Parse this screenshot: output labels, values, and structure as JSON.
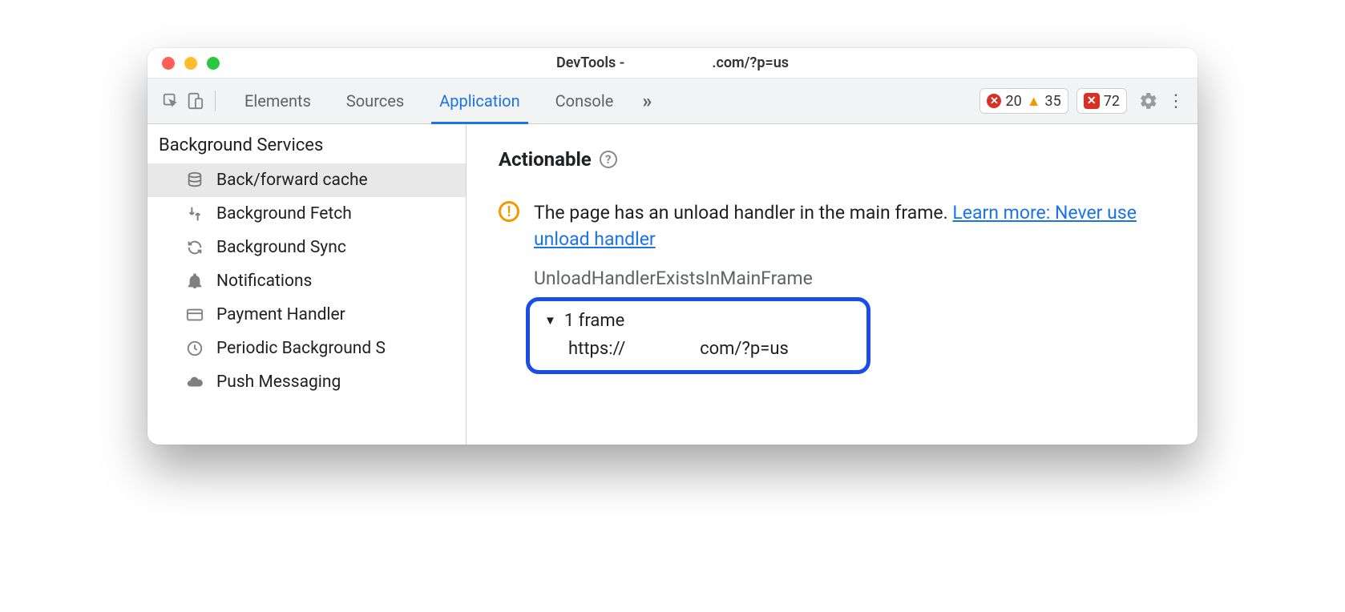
{
  "window": {
    "title_prefix": "DevTools - ",
    "title_url": ".com/?p=us"
  },
  "toolbar": {
    "tabs": {
      "elements": "Elements",
      "sources": "Sources",
      "application": "Application",
      "console": "Console"
    },
    "more": "»",
    "errors": "20",
    "warnings": "35",
    "issues": "72"
  },
  "sidebar": {
    "heading": "Background Services",
    "items": {
      "bfcache": "Back/forward cache",
      "bg_fetch": "Background Fetch",
      "bg_sync": "Background Sync",
      "notifications": "Notifications",
      "payment": "Payment Handler",
      "periodic": "Periodic Background S",
      "push": "Push Messaging"
    }
  },
  "main": {
    "section_title": "Actionable",
    "issue_text": "The page has an unload handler in the main frame. ",
    "issue_link": "Learn more: Never use unload handler",
    "reason_code": "UnloadHandlerExistsInMainFrame",
    "frame_summary": "1 frame",
    "frame_url": "https://                 com/?p=us"
  }
}
